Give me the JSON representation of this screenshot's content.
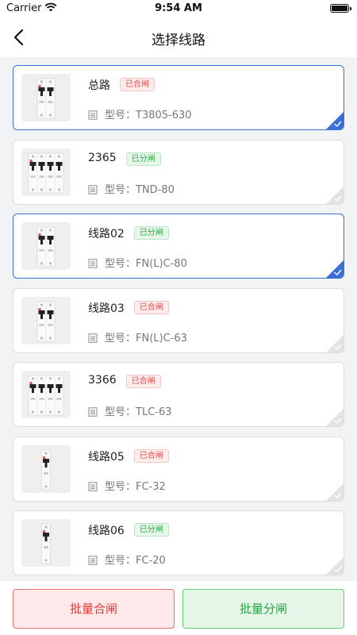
{
  "status_bar": {
    "carrier": "Carrier",
    "time": "9:54 AM"
  },
  "header": {
    "title": "选择线路",
    "back_icon": "chevron-left-icon"
  },
  "items": [
    {
      "name": "总路",
      "status": "已合闸",
      "state": "closed",
      "model_label": "型号：",
      "model": "T3805-630",
      "poles": 2,
      "selected": true
    },
    {
      "name": "2365",
      "status": "已分闸",
      "state": "open",
      "model_label": "型号：",
      "model": "TND-80",
      "poles": 4,
      "selected": false
    },
    {
      "name": "线路02",
      "status": "已分闸",
      "state": "open",
      "model_label": "型号：",
      "model": "FN(L)C-80",
      "poles": 2,
      "selected": true
    },
    {
      "name": "线路03",
      "status": "已合闸",
      "state": "closed",
      "model_label": "型号：",
      "model": "FN(L)C-63",
      "poles": 2,
      "selected": false
    },
    {
      "name": "3366",
      "status": "已合闸",
      "state": "closed",
      "model_label": "型号：",
      "model": "TLC-63",
      "poles": 4,
      "selected": false
    },
    {
      "name": "线路05",
      "status": "已合闸",
      "state": "closed",
      "model_label": "型号：",
      "model": "FC-32",
      "poles": 1,
      "selected": false
    },
    {
      "name": "线路06",
      "status": "已分闸",
      "state": "open",
      "model_label": "型号：",
      "model": "FC-20",
      "poles": 1,
      "selected": false
    }
  ],
  "footer": {
    "batch_close_label": "批量合闸",
    "batch_open_label": "批量分闸"
  },
  "colors": {
    "selected_border": "#3b6fd8",
    "closed_red": "#e04a4a",
    "open_green": "#29a640"
  }
}
